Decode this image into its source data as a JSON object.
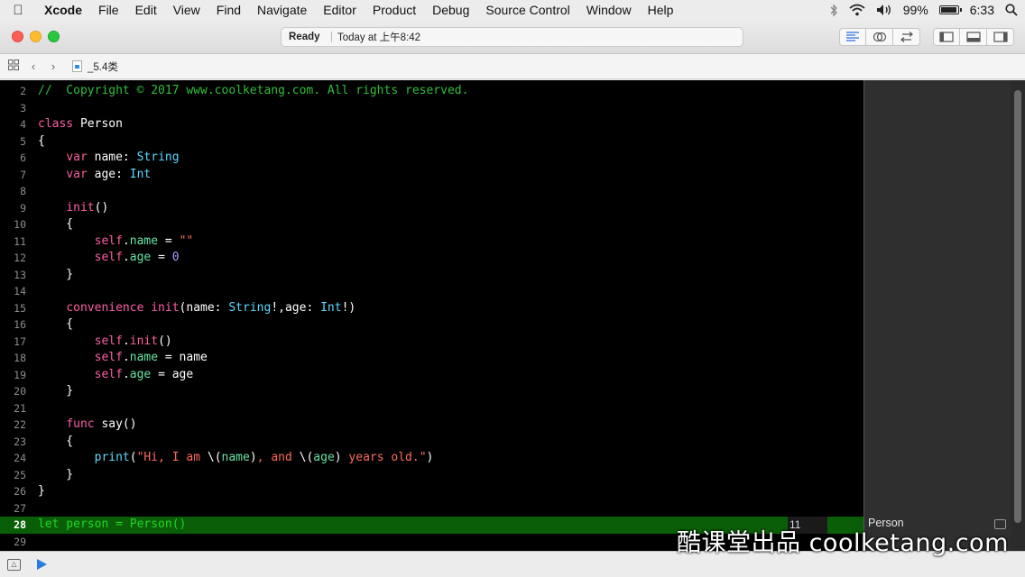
{
  "menubar": {
    "apple": "",
    "items": [
      "Xcode",
      "File",
      "Edit",
      "View",
      "Find",
      "Navigate",
      "Editor",
      "Product",
      "Debug",
      "Source Control",
      "Window",
      "Help"
    ],
    "battery_percent": "99%",
    "battery_level": 0.99,
    "time": "6:33",
    "icons": [
      "bluetooth-icon",
      "wifi-icon",
      "volume-icon",
      "battery-icon",
      "search-icon"
    ]
  },
  "toolbar": {
    "status_ready": "Ready",
    "status_time": "Today at 上午8:42"
  },
  "jumpbar": {
    "filename": "_5.4类"
  },
  "code": {
    "lines": [
      {
        "n": "2",
        "html": "<span class='cm'>//  Copyright © 2017 www.coolketang.com. All rights reserved.</span>"
      },
      {
        "n": "3",
        "html": ""
      },
      {
        "n": "4",
        "html": "<span class='kw'>class</span> Person"
      },
      {
        "n": "5",
        "html": "{"
      },
      {
        "n": "6",
        "html": "    <span class='kw'>var</span> name: <span class='ty'>String</span>"
      },
      {
        "n": "7",
        "html": "    <span class='kw'>var</span> age: <span class='ty'>Int</span>"
      },
      {
        "n": "8",
        "html": ""
      },
      {
        "n": "9",
        "html": "    <span class='kw'>init</span>()"
      },
      {
        "n": "10",
        "html": "    {"
      },
      {
        "n": "11",
        "html": "        <span class='kw'>self</span>.<span class='pr'>name</span> = <span class='st'>\"\"</span>"
      },
      {
        "n": "12",
        "html": "        <span class='kw'>self</span>.<span class='pr'>age</span> = <span class='nm'>0</span>"
      },
      {
        "n": "13",
        "html": "    }"
      },
      {
        "n": "14",
        "html": ""
      },
      {
        "n": "15",
        "html": "    <span class='kw'>convenience</span> <span class='kw'>init</span>(name: <span class='ty'>String</span>!,age: <span class='ty'>Int</span>!)"
      },
      {
        "n": "16",
        "html": "    {"
      },
      {
        "n": "17",
        "html": "        <span class='kw'>self</span>.<span class='kw'>init</span>()"
      },
      {
        "n": "18",
        "html": "        <span class='kw'>self</span>.<span class='pr'>name</span> = name"
      },
      {
        "n": "19",
        "html": "        <span class='kw'>self</span>.<span class='pr'>age</span> = age"
      },
      {
        "n": "20",
        "html": "    }"
      },
      {
        "n": "21",
        "html": ""
      },
      {
        "n": "22",
        "html": "    <span class='kw'>func</span> say()"
      },
      {
        "n": "23",
        "html": "    {"
      },
      {
        "n": "24",
        "html": "        <span class='ty'>print</span>(<span class='st'>\"Hi, I am </span>\\(<span class='pr'>name</span>)<span class='st'>, and </span>\\(<span class='pr'>age</span>)<span class='st'> years old.\"</span>)"
      },
      {
        "n": "25",
        "html": "    }"
      },
      {
        "n": "26",
        "html": "}"
      },
      {
        "n": "27",
        "html": ""
      },
      {
        "n": "28",
        "html": "let person = Person()",
        "highlight": true
      },
      {
        "n": "29",
        "html": ""
      }
    ],
    "result_count": "11"
  },
  "results": {
    "label": "Person"
  },
  "watermark": "酷课堂出品 coolketang.com"
}
